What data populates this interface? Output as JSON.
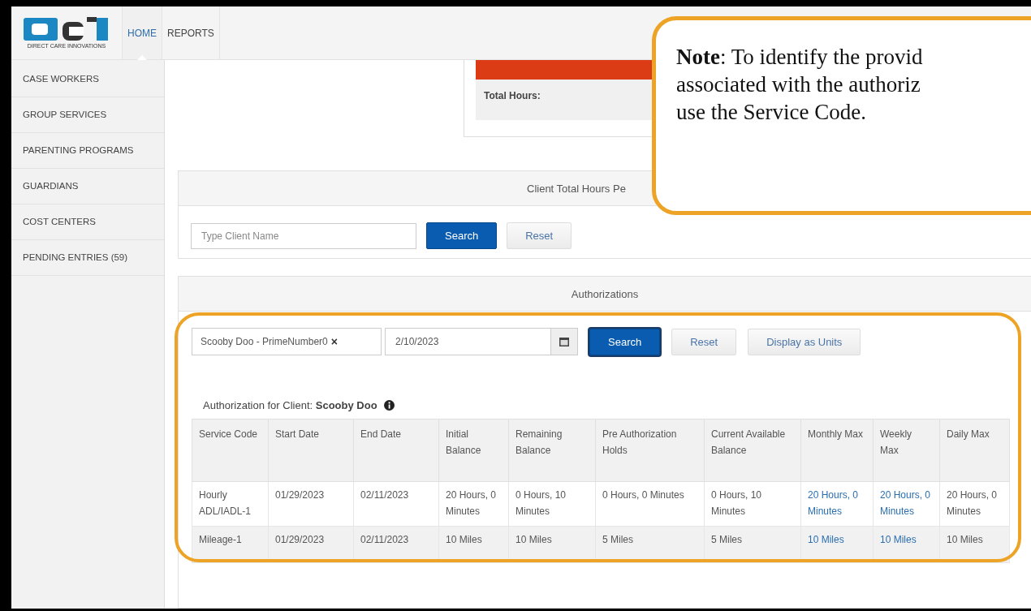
{
  "header": {
    "logo_caption": "DIRECT CARE INNOVATIONS",
    "tabs": [
      {
        "label": "HOME",
        "selected": true
      },
      {
        "label": "REPORTS",
        "selected": false
      }
    ]
  },
  "sidebar": {
    "items": [
      "CASE WORKERS",
      "GROUP SERVICES",
      "PARENTING PROGRAMS",
      "GUARDIANS",
      "COST CENTERS",
      "PENDING ENTRIES (59)"
    ]
  },
  "hours_card": {
    "label": "Total Hours:"
  },
  "client_hours_panel": {
    "title": "Client Total Hours Pe",
    "search": {
      "placeholder": "Type Client Name"
    },
    "buttons": [
      {
        "label": "Search",
        "kind": "primary"
      },
      {
        "label": "Reset",
        "kind": "default"
      }
    ]
  },
  "authorizations": {
    "title": "Authorizations",
    "client_select": {
      "value": "Scooby Doo - PrimeNumber0",
      "clear": "×"
    },
    "date": {
      "value": "2/10/2023"
    },
    "buttons": [
      {
        "label": "Search",
        "kind": "primary"
      },
      {
        "label": "Reset",
        "kind": "default"
      },
      {
        "label": "Display as Units",
        "kind": "default"
      }
    ],
    "client_label": "Authorization for Client: **Scooby Doo**",
    "table": {
      "columns": [
        {
          "label": "Service Code",
          "kind": "text"
        },
        {
          "label": "Start Date",
          "kind": "text"
        },
        {
          "label": "End Date",
          "kind": "text"
        },
        {
          "label": "Initial Balance",
          "kind": "text"
        },
        {
          "label": "Remaining Balance",
          "kind": "text"
        },
        {
          "label": "Pre Authorization Holds",
          "kind": "text"
        },
        {
          "label": "Current Available Balance",
          "kind": "text"
        },
        {
          "label": "Monthly Max",
          "kind": "link"
        },
        {
          "label": "Weekly Max",
          "kind": "link"
        },
        {
          "label": "Daily Max",
          "kind": "text"
        }
      ],
      "rows": [
        [
          "Hourly ADL/IADL-1",
          "01/29/2023",
          "02/11/2023",
          "20 Hours, 0 Minutes",
          "0 Hours, 10 Minutes",
          "0 Hours, 0 Minutes",
          "0 Hours, 10 Minutes",
          "20 Hours, 0 Minutes",
          "20 Hours, 0 Minutes",
          "20 Hours, 0 Minutes"
        ],
        [
          "Mileage-1",
          "01/29/2023",
          "02/11/2023",
          "10 Miles",
          "10 Miles",
          "5 Miles",
          "5 Miles",
          "10 Miles",
          "10 Miles",
          "10 Miles"
        ]
      ]
    }
  },
  "note": {
    "lines": [
      "**Note**: To identify the provid",
      "associated with the authoriz",
      "use the Service Code."
    ]
  }
}
